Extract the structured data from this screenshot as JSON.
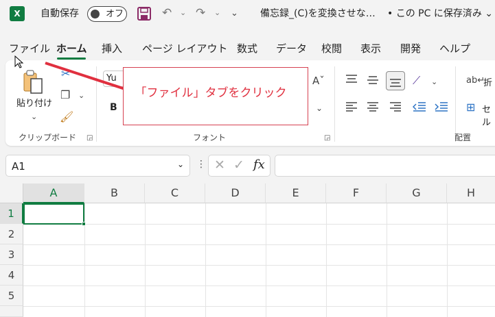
{
  "titlebar": {
    "app_logo": "X",
    "autosave_label": "自動保存",
    "autosave_state": "オフ",
    "filename": "備忘録_(C)を変換させな…",
    "save_status": "• この PC に保存済み ⌄"
  },
  "menu": {
    "tabs": [
      {
        "label": "ファイル"
      },
      {
        "label": "ホーム"
      },
      {
        "label": "挿入"
      },
      {
        "label": "ページ レイアウト"
      },
      {
        "label": "数式"
      },
      {
        "label": "データ"
      },
      {
        "label": "校閲"
      },
      {
        "label": "表示"
      },
      {
        "label": "開発"
      },
      {
        "label": "ヘルプ"
      }
    ],
    "active": "ホーム"
  },
  "ribbon": {
    "paste_label": "貼り付け",
    "clipboard_label": "クリップボード",
    "font_label": "フォント",
    "alignment_label": "配置",
    "font_name": "Yu",
    "bold": "B",
    "wrap_label": "折",
    "merge_label": "セル"
  },
  "callout": {
    "text": "「ファイル」タブをクリック",
    "color": "#e0303f"
  },
  "formula_bar": {
    "name_box": "A1",
    "fx": "fx"
  },
  "grid": {
    "columns": [
      "A",
      "B",
      "C",
      "D",
      "E",
      "F",
      "G",
      "H"
    ],
    "rows": [
      "1",
      "2",
      "3",
      "4",
      "5"
    ],
    "selected_cell": "A1"
  },
  "colors": {
    "accent": "#107c41"
  }
}
